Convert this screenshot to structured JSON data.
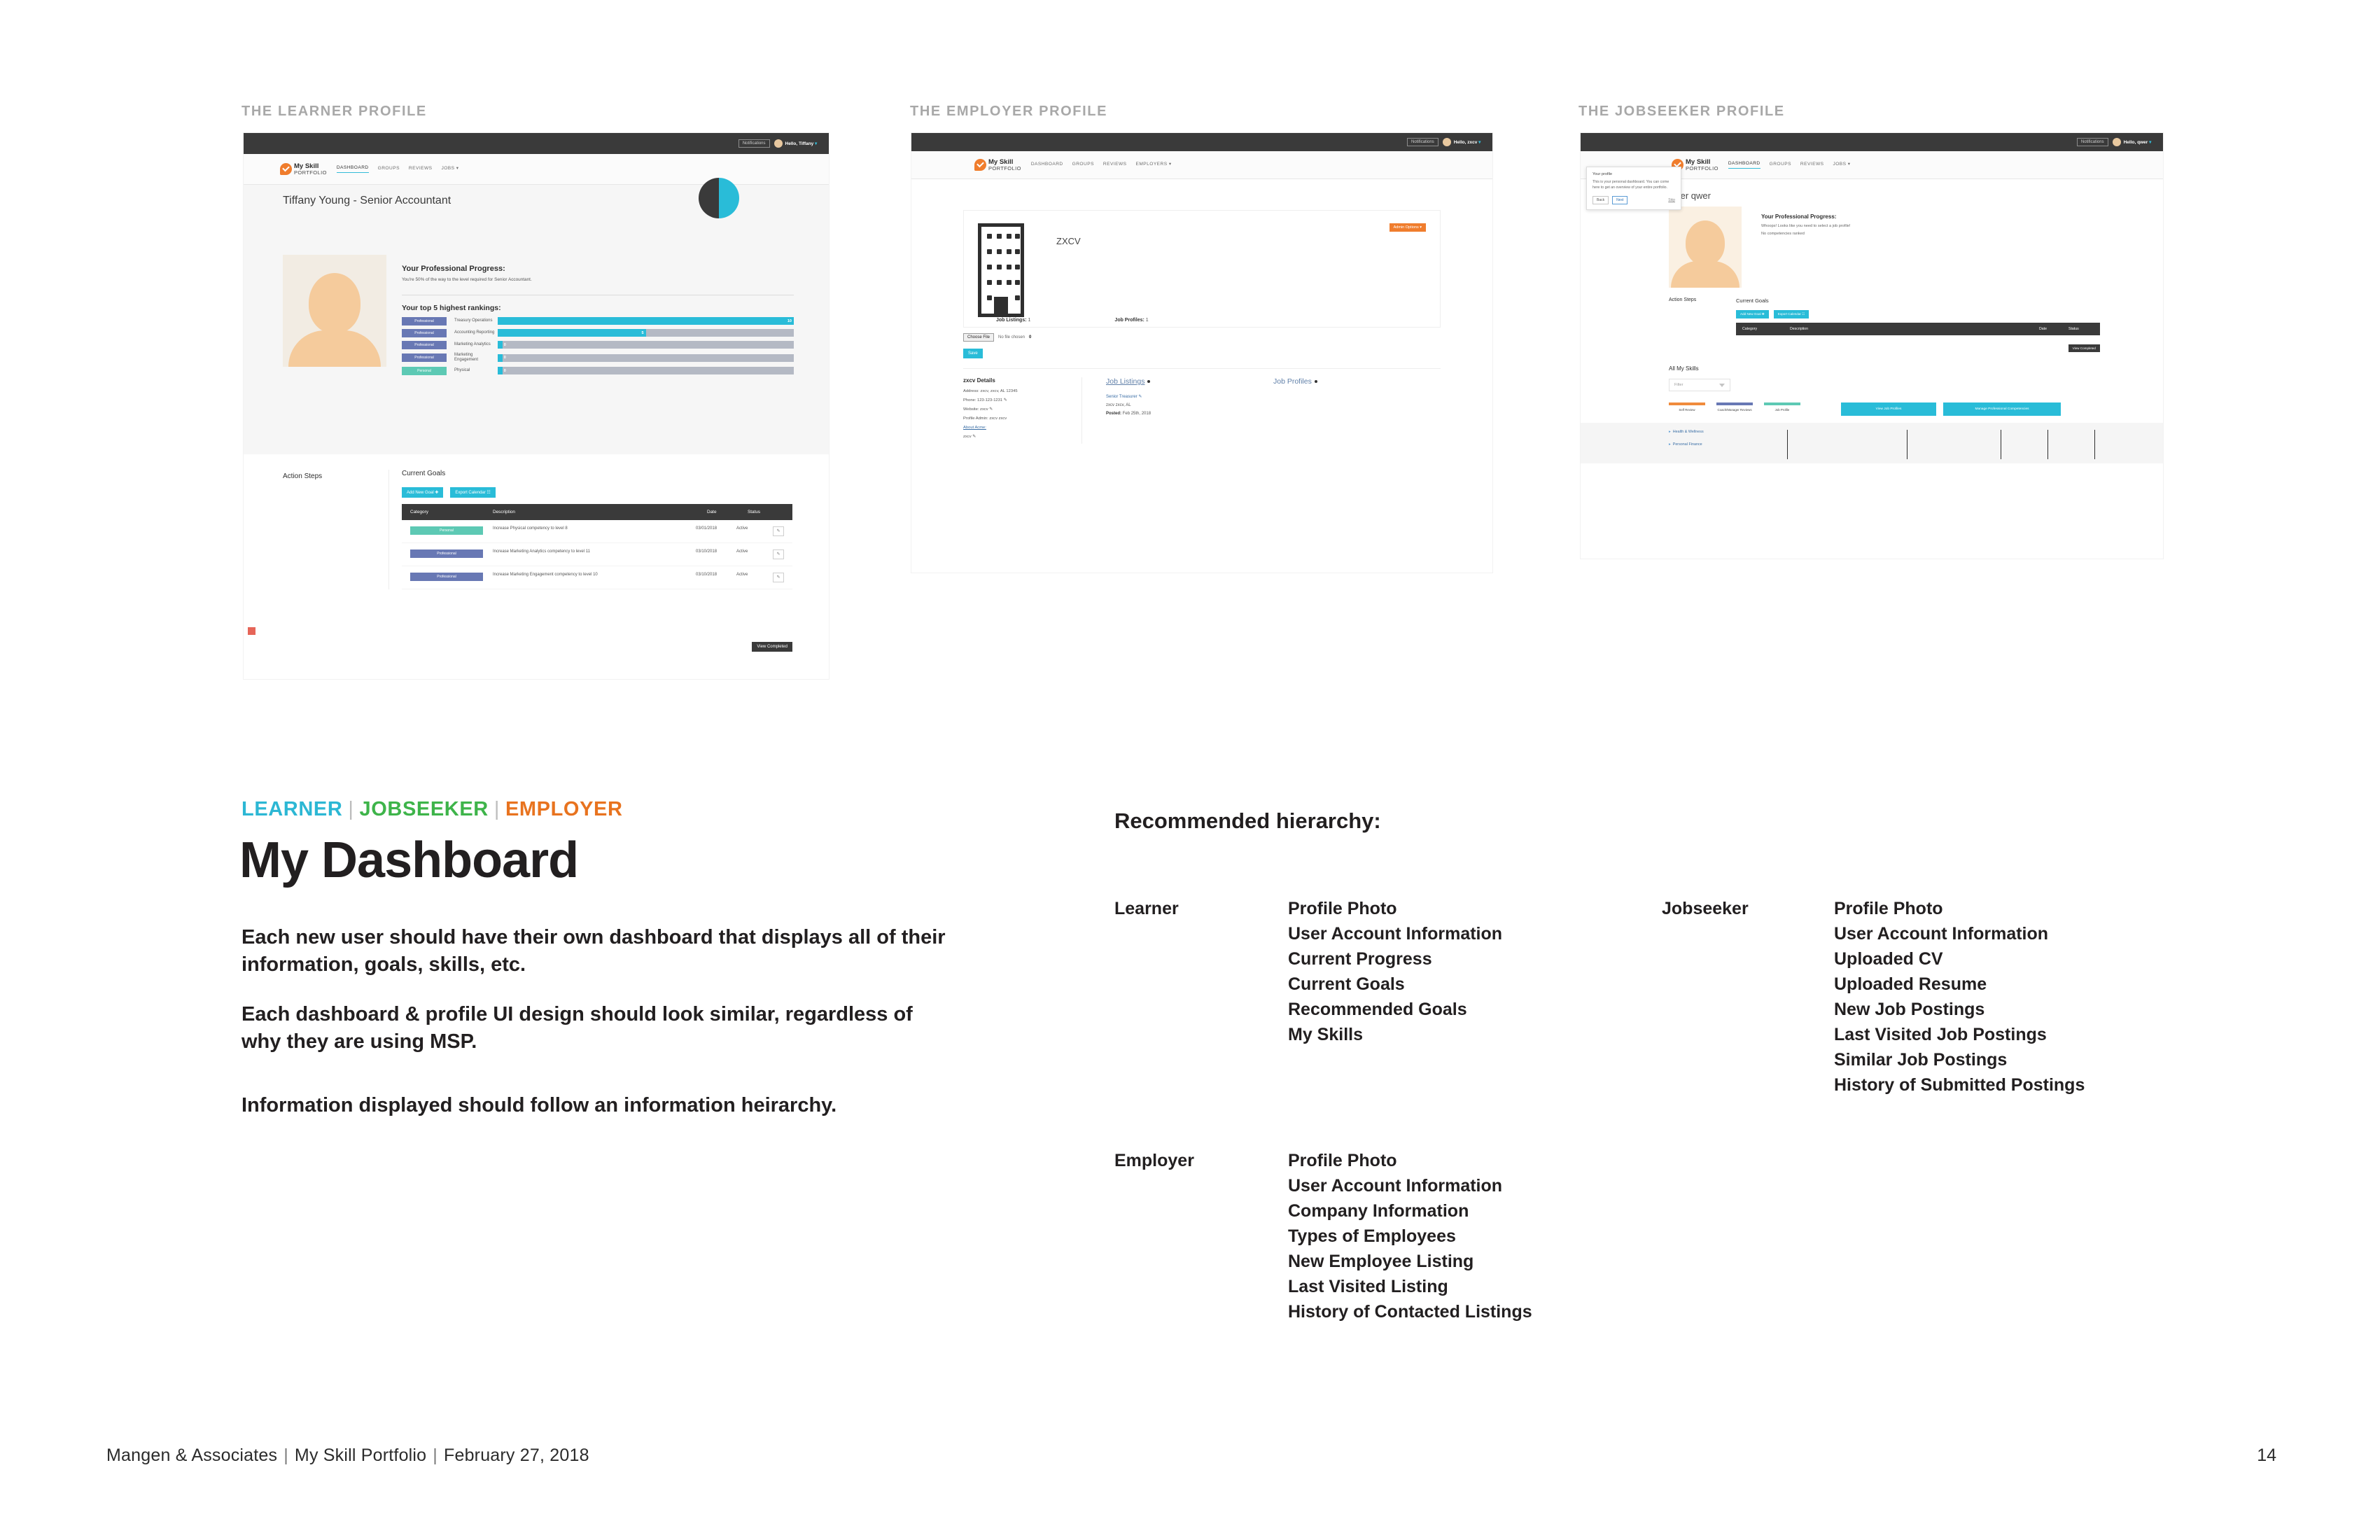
{
  "labels": {
    "learner_mock": "THE LEARNER PROFILE",
    "employer_mock": "THE EMPLOYER PROFILE",
    "jobseeker_mock": "THE JOBSEEKER PROFILE"
  },
  "brand": {
    "line1": "My Skill",
    "line2": "PORTFOLIO"
  },
  "learner_mock": {
    "topbar": {
      "notifications": "Notifications",
      "greeting": "Hello, Tiffany",
      "caret": "▾"
    },
    "nav": [
      "DASHBOARD",
      "GROUPS",
      "REVIEWS",
      "JOBS ▾"
    ],
    "title": "Tiffany Young - Senior Accountant",
    "progress": {
      "heading": "Your Professional Progress:",
      "text": "You're 50% of the way to the level required for Senior Accountant.",
      "percent": 50
    },
    "rankings_heading": "Your top 5 highest rankings:",
    "rankings": [
      {
        "tag": "Professional",
        "tag_type": "professional",
        "name": "Treasury Operations",
        "value": 10,
        "max": 10
      },
      {
        "tag": "Professional",
        "tag_type": "professional",
        "name": "Accounting Reporting",
        "value": 5,
        "max": 10
      },
      {
        "tag": "Professional",
        "tag_type": "professional",
        "name": "Marketing Analytics",
        "value": 0,
        "max": 10
      },
      {
        "tag": "Professional",
        "tag_type": "professional",
        "name": "Marketing Engagement",
        "value": 0,
        "max": 10
      },
      {
        "tag": "Personal",
        "tag_type": "personal",
        "name": "Physical",
        "value": 0,
        "max": 10
      }
    ],
    "action_steps_heading": "Action Steps",
    "current_goals_heading": "Current Goals",
    "buttons": {
      "add_goal": "Add New Goal ✚",
      "export_calendar": "Export Calendar ☷",
      "view_completed": "View Completed"
    },
    "table_headers": [
      "Category",
      "Description",
      "Date",
      "Status"
    ],
    "goals": [
      {
        "category": "Personal",
        "category_type": "personal",
        "description": "Increase Physical competency to level 8",
        "date": "03/01/2018",
        "status": "Active"
      },
      {
        "category": "Professional",
        "category_type": "professional",
        "description": "Increase Marketing Analytics competency to level 11",
        "date": "03/10/2018",
        "status": "Active"
      },
      {
        "category": "Professional",
        "category_type": "professional",
        "description": "Increase Marketing Engagement competency to level 10",
        "date": "03/10/2018",
        "status": "Active"
      }
    ]
  },
  "employer_mock": {
    "topbar": {
      "notifications": "Notifications",
      "greeting": "Hello, zxcv",
      "caret": "▾"
    },
    "nav": [
      "DASHBOARD",
      "GROUPS",
      "REVIEWS",
      "EMPLOYERS ▾"
    ],
    "company_name": "ZXCV",
    "admin_options": "Admin Options ▾",
    "stats": [
      {
        "label": "Job Listings:",
        "value": "1"
      },
      {
        "label": "Job Profiles:",
        "value": "1"
      }
    ],
    "file_input": {
      "button": "Choose File",
      "text": "No file chosen",
      "badge": "0"
    },
    "save_button": "Save",
    "details": {
      "title": "zxcv Details",
      "lines": [
        "Address: zxcv, zxcv, AL 12345",
        "Phone: 123-123-1231 ✎",
        "Website: zxcv ✎",
        "Profile Admin: zxcv zxcv"
      ],
      "about_link": "About Acme:",
      "about_value": "zxcv ✎"
    },
    "job_listings": {
      "title": "Job Listings",
      "items": [
        "Senior Treasurer ✎",
        "zxcv   zxcv, AL"
      ],
      "posted": "Posted:",
      "posted_date": "Feb 25th, 2018"
    },
    "job_profiles": {
      "title": "Job Profiles"
    }
  },
  "jobseeker_mock": {
    "topbar": {
      "notifications": "Notifications",
      "greeting": "Hello, qwer",
      "caret": "▾"
    },
    "nav": [
      "DASHBOARD",
      "GROUPS",
      "REVIEWS",
      "JOBS ▾"
    ],
    "tip": {
      "title": "Your profile",
      "body": "This is your personal dashboard. You can come here to get an overview of your entire portfolio.",
      "back": "Back",
      "next": "Next",
      "skip": "Skip"
    },
    "name": "qwer qwer",
    "progress": {
      "heading": "Your Professional Progress:",
      "line1": "Whoops! Looks like you need to select a job profile!",
      "line2": "No competencies ranked"
    },
    "action_steps_heading": "Action Steps",
    "current_goals_heading": "Current Goals",
    "buttons": {
      "add_goal": "Add New Goal ✚",
      "export_calendar": "Export Calendar ☷",
      "view_completed": "View Completed"
    },
    "table_headers": [
      "Category",
      "Description",
      "Date",
      "Status"
    ],
    "skills_heading": "All My Skills",
    "filter_placeholder": "Filter",
    "legend": [
      {
        "label": "Self Review",
        "color": "#f08b3c"
      },
      {
        "label": "Coach/Manager Reviews",
        "color": "#6878b4"
      },
      {
        "label": "Job Profile",
        "color": "#5dc9b4"
      }
    ],
    "skill_buttons": [
      "View Job Profiles",
      "Manage Professional Competencies"
    ],
    "categories": [
      "Health & Wellness",
      "Personal Finance"
    ]
  },
  "main": {
    "kicker": {
      "learner": "LEARNER",
      "jobseeker": "JOBSEEKER",
      "employer": "EMPLOYER",
      "separator": "|"
    },
    "headline": "My Dashboard",
    "paragraphs": [
      "Each new user should have their own dashboard that displays all of their information, goals, skills, etc.",
      "Each dashboard & profile UI design should look similar, regardless of why they are using MSP.",
      "Information displayed should follow an information heirarchy."
    ]
  },
  "hierarchy": {
    "title": "Recommended hierarchy:",
    "learner": {
      "role": "Learner",
      "items": [
        "Profile Photo",
        "User Account Information",
        "Current Progress",
        "Current Goals",
        "Recommended Goals",
        "My Skills"
      ]
    },
    "jobseeker": {
      "role": "Jobseeker",
      "items": [
        "Profile Photo",
        "User Account Information",
        "Uploaded CV",
        "Uploaded Resume",
        "New Job Postings",
        "Last Visited Job Postings",
        "Similar Job Postings",
        "History of Submitted Postings"
      ]
    },
    "employer": {
      "role": "Employer",
      "items": [
        "Profile Photo",
        "User Account Information",
        "Company Information",
        "Types of Employees",
        "New Employee Listing",
        "Last Visited Listing",
        "History of Contacted Listings"
      ]
    }
  },
  "footer": {
    "company": "Mangen & Associates",
    "project": "My Skill Portfolio",
    "date": "February 27, 2018",
    "page": "14"
  },
  "colors": {
    "learner": "#2cb7d4",
    "jobseeker": "#3eb44a",
    "employer": "#e8731f",
    "cyan": "#29bcd8",
    "dark": "#3a3a3a",
    "orange": "#f07d2d",
    "professional": "#6878b4",
    "personal": "#5dc9b4"
  }
}
